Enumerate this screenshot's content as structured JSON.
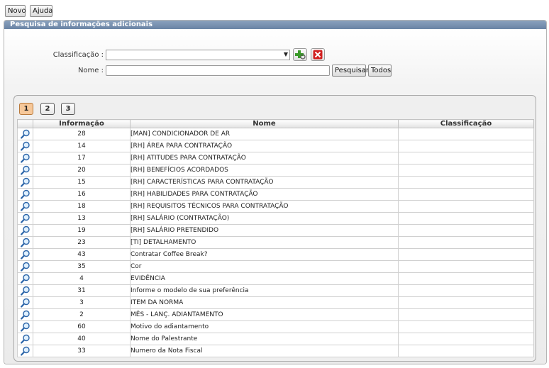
{
  "toolbar": {
    "new_label": "Novo",
    "help_label": "Ajuda"
  },
  "panel": {
    "title": "Pesquisa de informações adicionais"
  },
  "filters": {
    "classification_label": "Classificação :",
    "classification_value": "",
    "name_label": "Nome :",
    "name_value": "",
    "search_label": "Pesquisar",
    "all_label": "Todos"
  },
  "pager": {
    "pages": [
      "1",
      "2",
      "3"
    ],
    "current": "1"
  },
  "table": {
    "headers": {
      "info": "Informação",
      "name": "Nome",
      "classification": "Classificação"
    },
    "rows": [
      {
        "info": "28",
        "name": "[MAN] CONDICIONADOR DE AR",
        "classification": ""
      },
      {
        "info": "14",
        "name": "[RH] ÁREA PARA CONTRATAÇÃO",
        "classification": ""
      },
      {
        "info": "17",
        "name": "[RH] ATITUDES PARA CONTRATAÇÃO",
        "classification": ""
      },
      {
        "info": "20",
        "name": "[RH] BENEFÍCIOS ACORDADOS",
        "classification": ""
      },
      {
        "info": "15",
        "name": "[RH] CARACTERÍSTICAS PARA CONTRATAÇÃO",
        "classification": ""
      },
      {
        "info": "16",
        "name": "[RH] HABILIDADES PARA CONTRATAÇÃO",
        "classification": ""
      },
      {
        "info": "18",
        "name": "[RH] REQUISITOS TÉCNICOS PARA CONTRATAÇÃO",
        "classification": ""
      },
      {
        "info": "13",
        "name": "[RH] SALÁRIO (CONTRATAÇÃO)",
        "classification": ""
      },
      {
        "info": "19",
        "name": "[RH] SALÁRIO PRETENDIDO",
        "classification": ""
      },
      {
        "info": "23",
        "name": "[TI] DETALHAMENTO",
        "classification": ""
      },
      {
        "info": "43",
        "name": "Contratar Coffee Break?",
        "classification": ""
      },
      {
        "info": "35",
        "name": "Cor",
        "classification": ""
      },
      {
        "info": "4",
        "name": "EVIDÊNCIA",
        "classification": ""
      },
      {
        "info": "31",
        "name": "Informe o modelo de sua preferência",
        "classification": ""
      },
      {
        "info": "3",
        "name": "ITEM DA NORMA",
        "classification": ""
      },
      {
        "info": "2",
        "name": "MÊS - LANÇ. ADIANTAMENTO",
        "classification": ""
      },
      {
        "info": "60",
        "name": "Motivo do adiantamento",
        "classification": ""
      },
      {
        "info": "40",
        "name": "Nome do Palestrante",
        "classification": ""
      },
      {
        "info": "33",
        "name": "Numero da Nota Fiscal",
        "classification": ""
      }
    ]
  },
  "colors": {
    "header_bar": "#7590b2",
    "active_page": "#f6c89a",
    "add_icon": "#3a9a2a",
    "delete_icon": "#d12020"
  },
  "icons": {
    "row_view": "magnifier-icon",
    "add": "add-icon",
    "delete": "delete-icon",
    "dropdown": "chevron-down-icon"
  }
}
